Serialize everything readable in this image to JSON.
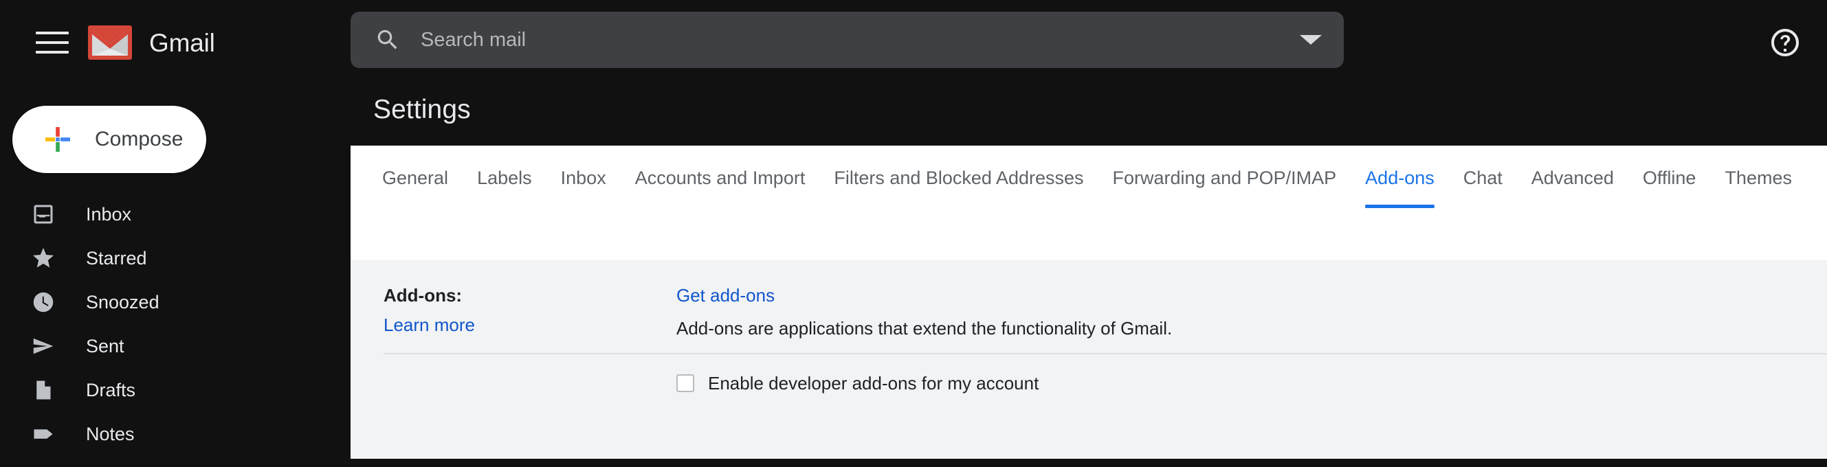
{
  "topbar": {
    "menu_icon": "hamburger-menu-icon",
    "brand": "Gmail",
    "logo_icon": "gmail-envelope-logo",
    "help_icon": "help-question-circle-icon"
  },
  "search": {
    "placeholder": "Search mail",
    "value": "",
    "icon": "search-icon",
    "options_icon": "chevron-down-icon"
  },
  "sidebar": {
    "compose": {
      "label": "Compose",
      "icon": "plus-icon"
    },
    "items": [
      {
        "label": "Inbox",
        "icon": "inbox-icon"
      },
      {
        "label": "Starred",
        "icon": "star-icon"
      },
      {
        "label": "Snoozed",
        "icon": "clock-icon"
      },
      {
        "label": "Sent",
        "icon": "send-paper-plane-icon"
      },
      {
        "label": "Drafts",
        "icon": "document-icon"
      },
      {
        "label": "Notes",
        "icon": "label-tag-icon"
      }
    ]
  },
  "page": {
    "title": "Settings"
  },
  "tabs": [
    {
      "label": "General",
      "active": false
    },
    {
      "label": "Labels",
      "active": false
    },
    {
      "label": "Inbox",
      "active": false
    },
    {
      "label": "Accounts and Import",
      "active": false
    },
    {
      "label": "Filters and Blocked Addresses",
      "active": false
    },
    {
      "label": "Forwarding and POP/IMAP",
      "active": false
    },
    {
      "label": "Add-ons",
      "active": true
    },
    {
      "label": "Chat",
      "active": false
    },
    {
      "label": "Advanced",
      "active": false
    },
    {
      "label": "Offline",
      "active": false
    },
    {
      "label": "Themes",
      "active": false
    }
  ],
  "settings": {
    "addons_row": {
      "label": "Add-ons:",
      "learn_more": "Learn more",
      "get_addons": "Get add-ons",
      "description": "Add-ons are applications that extend the functionality of Gmail."
    },
    "developer_row": {
      "checkbox_label": "Enable developer add-ons for my account",
      "checked": false
    }
  },
  "colors": {
    "chrome_bg": "#111111",
    "search_bg": "#3f4043",
    "accent_blue": "#1a73e8",
    "link_blue": "#1155cc",
    "panel_bg": "#ffffff",
    "body_bg": "#f1f3f4"
  }
}
